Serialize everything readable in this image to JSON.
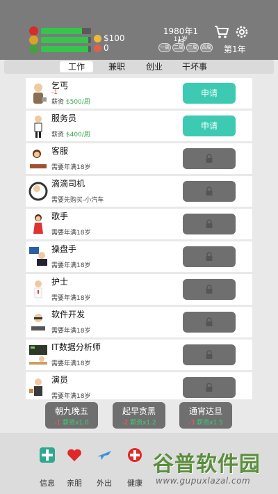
{
  "header": {
    "money": "$100",
    "gems": "0",
    "date": "1980年1月",
    "age": "11岁",
    "speeds": [
      "一周",
      "二周",
      "三周",
      "四周"
    ],
    "year": "第1年",
    "stats": [
      {
        "name": "health",
        "color": "#d62b2b",
        "progress": 0.82
      },
      {
        "name": "happiness",
        "color": "#d6a22b",
        "progress": 0.95
      },
      {
        "name": "intelligence",
        "color": "#47a03e",
        "progress": 0.95
      }
    ]
  },
  "tabs": [
    {
      "label": "工作",
      "active": true
    },
    {
      "label": "兼职",
      "active": false
    },
    {
      "label": "创业",
      "active": false
    },
    {
      "label": "干坏事",
      "active": false
    }
  ],
  "jobs": [
    {
      "title": "乞丐",
      "req": "-1",
      "salary_prefix": "薪资 ",
      "salary": "$500/周",
      "button": "申请",
      "locked": false
    },
    {
      "title": "服务员",
      "salary_prefix": "薪资 ",
      "salary": "$400/周",
      "button": "申请",
      "locked": false
    },
    {
      "title": "客服",
      "note": "需要年满18岁",
      "locked": true
    },
    {
      "title": "滴滴司机",
      "note": "需要先购买-小汽车",
      "locked": true
    },
    {
      "title": "歌手",
      "note": "需要年满18岁",
      "locked": true
    },
    {
      "title": "操盘手",
      "note": "需要年满18岁",
      "locked": true
    },
    {
      "title": "护士",
      "note": "需要年满18岁",
      "locked": true
    },
    {
      "title": "软件开发",
      "note": "需要年满18岁",
      "locked": true
    },
    {
      "title": "IT数据分析师",
      "note": "需要年满18岁",
      "locked": true
    },
    {
      "title": "演员",
      "note": "需要年满18岁",
      "locked": true
    }
  ],
  "modes": [
    {
      "title": "朝九晚五",
      "cost": "-1",
      "salary": "薪资x1.0"
    },
    {
      "title": "起早贪黑",
      "cost": "-2",
      "salary": "薪资x1.2"
    },
    {
      "title": "通宵达旦",
      "cost": "-3",
      "salary": "薪资x1.5"
    }
  ],
  "nav": [
    {
      "label": "信息",
      "icon": "info-icon"
    },
    {
      "label": "亲朋",
      "icon": "heart-icon"
    },
    {
      "label": "外出",
      "icon": "plane-icon"
    },
    {
      "label": "健康",
      "icon": "health-icon"
    }
  ],
  "watermark": {
    "main": "谷普软件园",
    "url": "www.gupuxlazal.com"
  },
  "colors": {
    "accent": "#3ccab2",
    "header": "#7b7b7b",
    "locked": "#6f6f6f"
  }
}
